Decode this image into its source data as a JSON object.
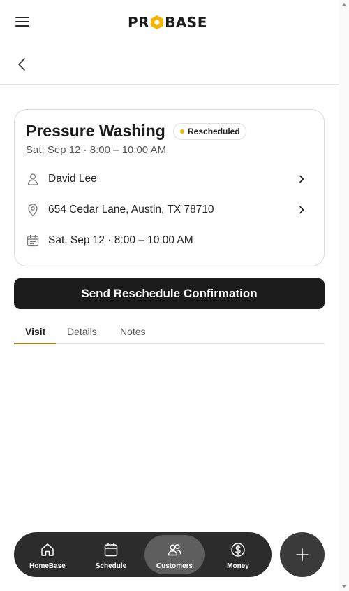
{
  "header": {
    "logo_text_left": "PR",
    "logo_text_right": "BASE"
  },
  "visit": {
    "title": "Pressure Washing",
    "status": "Rescheduled",
    "status_color": "#f4b400",
    "subtitle": "Sat, Sep 12 · 8:00 – 10:00 AM",
    "customer": "David Lee",
    "address": "654 Cedar Lane, Austin, TX 78710",
    "schedule": "Sat, Sep 12 · 8:00 – 10:00 AM"
  },
  "cta_label": "Send Reschedule Confirmation",
  "tabs": [
    {
      "label": "Visit",
      "active": true
    },
    {
      "label": "Details",
      "active": false
    },
    {
      "label": "Notes",
      "active": false
    }
  ],
  "bottom_nav": [
    {
      "label": "HomeBase",
      "icon": "home-icon",
      "active": false
    },
    {
      "label": "Schedule",
      "icon": "calendar-icon",
      "active": false
    },
    {
      "label": "Customers",
      "icon": "users-icon",
      "active": true
    },
    {
      "label": "Money",
      "icon": "dollar-icon",
      "active": false
    }
  ],
  "fab_icon": "plus-icon",
  "accent_color": "#a3822a"
}
